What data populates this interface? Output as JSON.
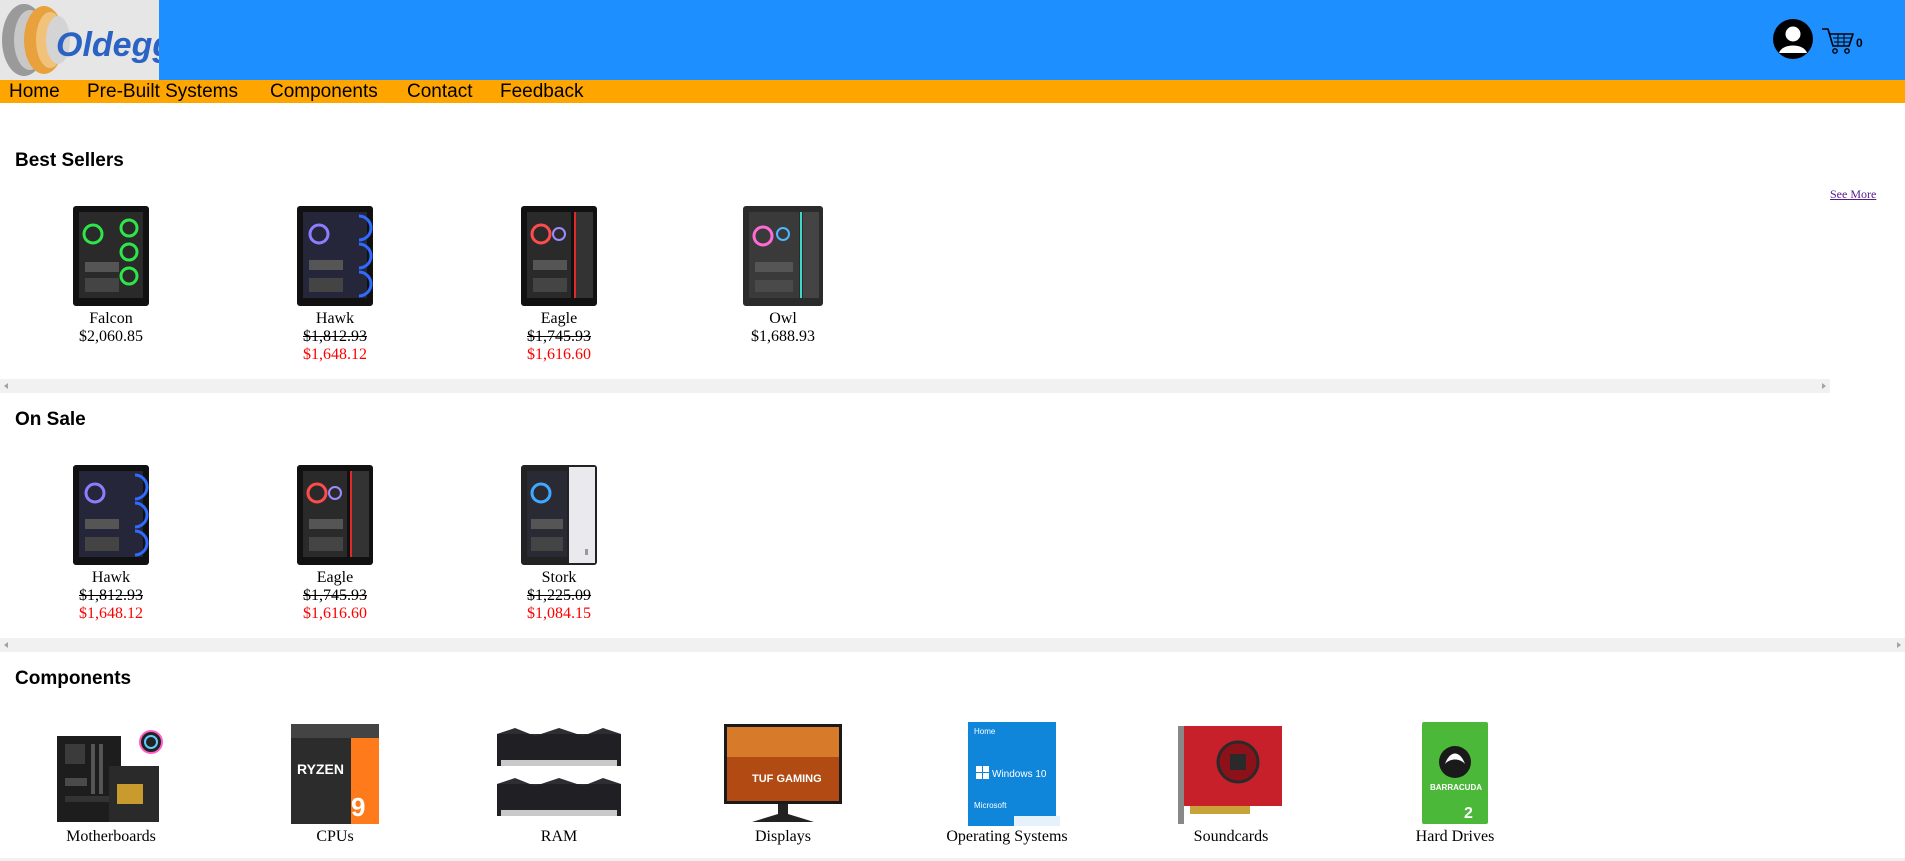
{
  "header": {
    "logo_text": "Oldegg",
    "cart_count": "0",
    "icons": {
      "user": "user-avatar-icon",
      "cart": "shopping-cart-icon"
    },
    "colors": {
      "header_bg": "#1e8fff",
      "nav_bg": "#ffa500",
      "sale_price": "#ff0000"
    }
  },
  "nav": {
    "items": [
      "Home",
      "Pre-Built Systems",
      "Components",
      "Contact",
      "Feedback"
    ]
  },
  "best_sellers": {
    "title": "Best Sellers",
    "see_more": "See More",
    "products": [
      {
        "name": "Falcon",
        "price": "$2,060.85"
      },
      {
        "name": "Hawk",
        "old_price": "$1,812.93",
        "sale_price": "$1,648.12"
      },
      {
        "name": "Eagle",
        "old_price": "$1,745.93",
        "sale_price": "$1,616.60"
      },
      {
        "name": "Owl",
        "price": "$1,688.93"
      }
    ]
  },
  "on_sale": {
    "title": "On Sale",
    "products": [
      {
        "name": "Hawk",
        "old_price": "$1,812.93",
        "sale_price": "$1,648.12"
      },
      {
        "name": "Eagle",
        "old_price": "$1,745.93",
        "sale_price": "$1,616.60"
      },
      {
        "name": "Stork",
        "old_price": "$1,225.09",
        "sale_price": "$1,084.15"
      }
    ]
  },
  "components": {
    "title": "Components",
    "items": [
      {
        "name": "Motherboards"
      },
      {
        "name": "CPUs",
        "img_text": "RYZEN"
      },
      {
        "name": "RAM"
      },
      {
        "name": "Displays",
        "img_text": "TUF GAMING"
      },
      {
        "name": "Operating Systems",
        "img_text": "Windows 10",
        "img_top": "Home",
        "img_bottom": "Microsoft"
      },
      {
        "name": "Soundcards"
      },
      {
        "name": "Hard Drives",
        "img_text": "BARRACUDA"
      }
    ]
  }
}
